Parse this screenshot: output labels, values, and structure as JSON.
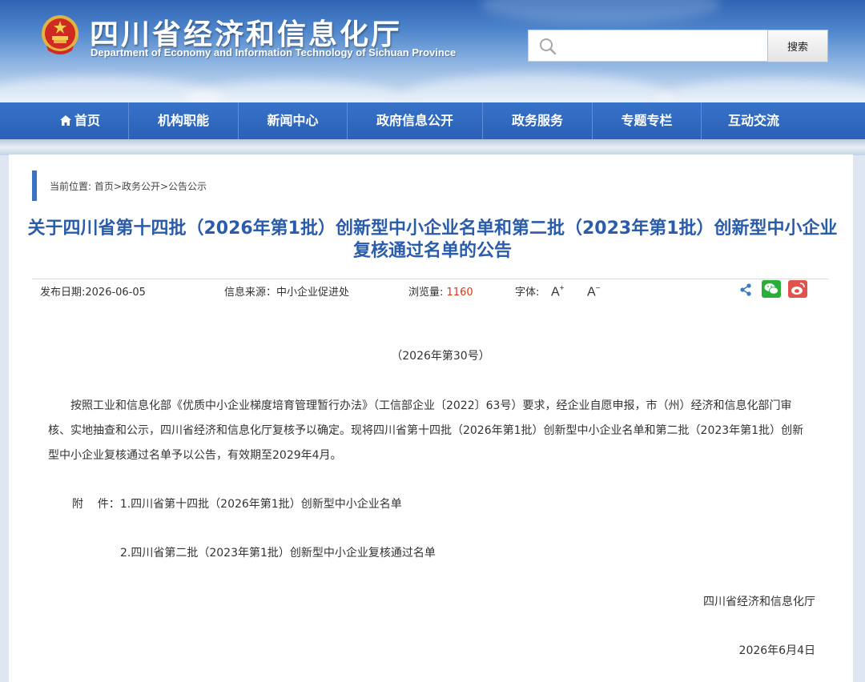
{
  "header": {
    "title": "四川省经济和信息化厅",
    "subtitle": "Department of Economy and Information Technology of Sichuan Province",
    "search_placeholder": "",
    "search_button": "搜索"
  },
  "nav": {
    "items": [
      "首页",
      "机构职能",
      "新闻中心",
      "政府信息公开",
      "政务服务",
      "专题专栏",
      "互动交流"
    ]
  },
  "breadcrumb": {
    "prefix": "当前位置:",
    "home": "首页",
    "sep1": ">",
    "section": "政务公开",
    "sep2": ">",
    "current": "公告公示"
  },
  "article": {
    "title": "关于四川省第十四批（2026年第1批）创新型中小企业名单和第二批（2023年第1批）创新型中小企业复核通过名单的公告",
    "meta": {
      "date": "发布日期:2026-06-05",
      "source": "信息来源：中小企业促进处",
      "views_label": "浏览量:",
      "views": "1160",
      "font_label": "字体:",
      "font_up": "A",
      "font_up_sign": "+",
      "font_down": "A",
      "font_down_sign": "−"
    },
    "doc_number": "（2026年第30号）",
    "body": "按照工业和信息化部《优质中小企业梯度培育管理暂行办法》（工信部企业〔2022〕63号）要求，经企业自愿申报，市（州）经济和信息化部门审核、实地抽查和公示，四川省经济和信息化厅复核予以确定。现将四川省第十四批（2026年第1批）创新型中小企业名单和第二批（2023年第1批）创新型中小企业复核通过名单予以公告，有效期至2029年4月。",
    "attachment_label": "附    件：",
    "attachments": [
      "1.四川省第十四批（2026年第1批）创新型中小企业名单",
      "2.四川省第二批（2023年第1批）创新型中小企业复核通过名单"
    ],
    "signature": "四川省经济和信息化厅",
    "sign_date": "2026年6月4日"
  },
  "colors": {
    "nav_bg": "#2b60b5",
    "title_blue": "#2a5cab",
    "views_red": "#d9351c",
    "wechat_green": "#2aae3a",
    "weibo_red": "#e0524c"
  },
  "icons": [
    "emblem-icon",
    "search-icon",
    "home-icon",
    "share-icon",
    "wechat-icon",
    "weibo-icon"
  ]
}
